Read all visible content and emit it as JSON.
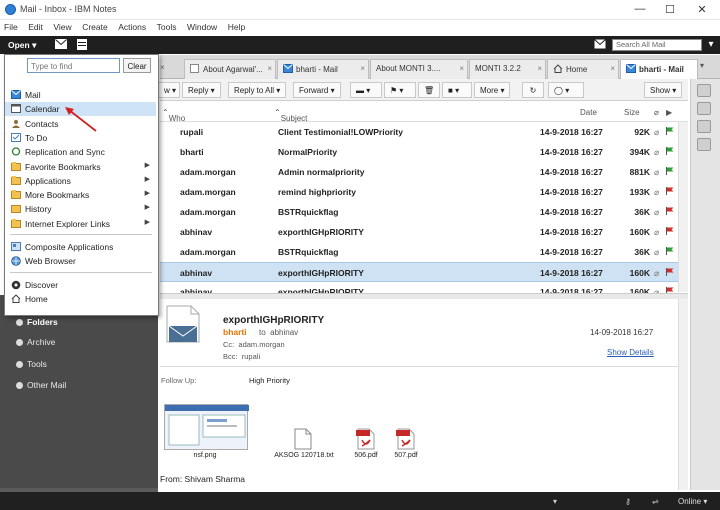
{
  "window": {
    "title": "Mail - Inbox - IBM Notes",
    "controls": [
      "—",
      "☐",
      "✕"
    ]
  },
  "menubar": [
    "File",
    "Edit",
    "View",
    "Create",
    "Actions",
    "Tools",
    "Window",
    "Help"
  ],
  "topbar": {
    "open_label": "Open ▾",
    "search_placeholder": "Search All Mail"
  },
  "tabs": [
    {
      "label": "About Agarwal'...",
      "icon": "page-icon",
      "active": false
    },
    {
      "label": "bharti - Mail",
      "icon": "mail-icon",
      "active": false
    },
    {
      "label": "About MONTI 3....",
      "icon": "page-icon",
      "active": false
    },
    {
      "label": "MONTI 3.2.2",
      "icon": "page-icon",
      "active": false
    },
    {
      "label": "Home",
      "icon": "home-icon",
      "active": false
    },
    {
      "label": "bharti - Mail",
      "icon": "mail-icon",
      "active": true
    }
  ],
  "actions": [
    "w ▾",
    "Reply ▾",
    "Reply to All ▾",
    "Forward ▾",
    "▾",
    "▾",
    "",
    "▾",
    "More ▾",
    "",
    "▾",
    "Show ▾"
  ],
  "list_headers": {
    "who": "Who",
    "subject": "Subject",
    "date": "Date",
    "size": "Size"
  },
  "emails": [
    {
      "who": "rupali",
      "subject": "Client Testimonial!LOWPriority",
      "date": "14-9-2018 16:27",
      "size": "92K",
      "flag": "green",
      "selected": false
    },
    {
      "who": "bharti",
      "subject": "NormalPriority",
      "date": "14-9-2018 16:27",
      "size": "394K",
      "flag": "green",
      "selected": false
    },
    {
      "who": "adam.morgan",
      "subject": "Admin normalpriority",
      "date": "14-9-2018 16:27",
      "size": "881K",
      "flag": "green",
      "selected": false
    },
    {
      "who": "adam.morgan",
      "subject": "remind highpriority",
      "date": "14-9-2018 16:27",
      "size": "193K",
      "flag": "red",
      "selected": false
    },
    {
      "who": "adam.morgan",
      "subject": "BSTRquickflag",
      "date": "14-9-2018 16:27",
      "size": "36K",
      "flag": "red",
      "selected": false
    },
    {
      "who": "abhinav",
      "subject": "exporthIGHpRIORITY",
      "date": "14-9-2018 16:27",
      "size": "160K",
      "flag": "red",
      "selected": false
    },
    {
      "who": "adam.morgan",
      "subject": "BSTRquickflag",
      "date": "14-9-2018 16:27",
      "size": "36K",
      "flag": "green",
      "selected": false
    },
    {
      "who": "abhinav",
      "subject": "exporthIGHpRIORITY",
      "date": "14-9-2018 16:27",
      "size": "160K",
      "flag": "red",
      "selected": true
    },
    {
      "who": "abhinav",
      "subject": "exporthIGHpRIORITY",
      "date": "14-9-2018 16:27",
      "size": "160K",
      "flag": "red",
      "selected": false
    }
  ],
  "open_menu": {
    "find_placeholder": "Type to find",
    "clear_label": "Clear",
    "group1": [
      {
        "label": "Mail",
        "icon": "mail-icon",
        "submenu": false,
        "highlight": false
      },
      {
        "label": "Calendar",
        "icon": "calendar-icon",
        "submenu": false,
        "highlight": true
      },
      {
        "label": "Contacts",
        "icon": "contacts-icon",
        "submenu": false,
        "highlight": false
      },
      {
        "label": "To Do",
        "icon": "todo-icon",
        "submenu": false,
        "highlight": false
      },
      {
        "label": "Replication and Sync",
        "icon": "replication-icon",
        "submenu": false,
        "highlight": false
      },
      {
        "label": "Favorite Bookmarks",
        "icon": "bookmark-icon",
        "submenu": true,
        "highlight": false
      },
      {
        "label": "Applications",
        "icon": "folder-icon",
        "submenu": true,
        "highlight": false
      },
      {
        "label": "More Bookmarks",
        "icon": "folder-icon",
        "submenu": true,
        "highlight": false
      },
      {
        "label": "History",
        "icon": "history-icon",
        "submenu": true,
        "highlight": false
      },
      {
        "label": "Internet Explorer Links",
        "icon": "folder-icon",
        "submenu": true,
        "highlight": false
      }
    ],
    "group2": [
      {
        "label": "Composite Applications",
        "icon": "composite-icon",
        "submenu": false,
        "highlight": false
      },
      {
        "label": "Web Browser",
        "icon": "globe-icon",
        "submenu": false,
        "highlight": false
      }
    ],
    "group3": [
      {
        "label": "Discover",
        "icon": "discover-icon",
        "submenu": false,
        "highlight": false
      },
      {
        "label": "Home",
        "icon": "home-icon",
        "submenu": false,
        "highlight": false
      }
    ]
  },
  "left_panel": [
    "Folders",
    "Archive",
    "Tools",
    "Other Mail"
  ],
  "preview": {
    "subject": "exporthIGHpRIORITY",
    "from": "bharti",
    "to_label": "to",
    "to": "abhinav",
    "cc_label": "Cc:",
    "cc": "adam.morgan",
    "bcc_label": "Bcc:",
    "bcc": "rupali",
    "date": "14-09-2018 16:27",
    "show_details": "Show Details",
    "follow_up_label": "Follow Up:",
    "follow_up_value": "High Priority",
    "attachments": [
      {
        "name": "nsf.png",
        "type": "image"
      },
      {
        "name": "AKSOG 120718.txt",
        "type": "text"
      },
      {
        "name": "506.pdf",
        "type": "pdf"
      },
      {
        "name": "507.pdf",
        "type": "pdf"
      }
    ],
    "from_signature": "From: Shivam Sharma"
  },
  "status": {
    "online": "Online ▾"
  },
  "colors": {
    "accent_orange": "#e67300",
    "link_blue": "#2b5fb3",
    "selection": "#cfe2f3",
    "flag_red": "#d22b2b",
    "flag_green": "#2e9e3a"
  }
}
